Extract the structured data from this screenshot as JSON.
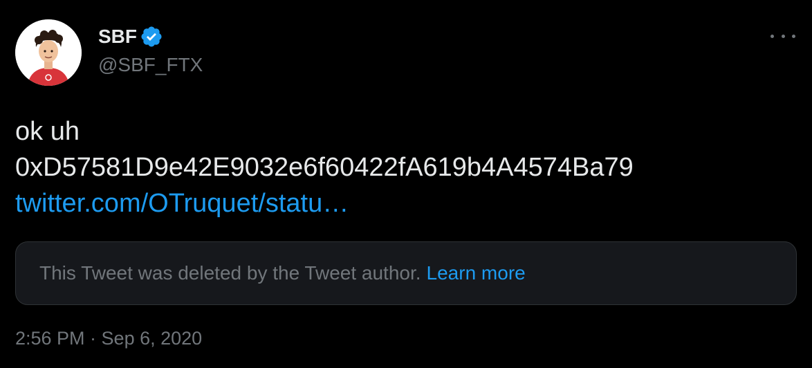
{
  "author": {
    "display_name": "SBF",
    "handle": "@SBF_FTX",
    "verified": true,
    "avatar_icon": "profile-photo-avatar"
  },
  "more_menu_icon": "more-horizontal-icon",
  "tweet": {
    "line1": "ok uh",
    "line2": "0xD57581D9e42E9032e6f60422fA619b4A4574Ba79",
    "link_text": "twitter.com/OTruquet/statu…"
  },
  "quoted_tweet": {
    "deleted_message": "This Tweet was deleted by the Tweet author.",
    "learn_more_label": "Learn more"
  },
  "timestamp": "2:56 PM · Sep 6, 2020",
  "colors": {
    "background": "#000000",
    "text_primary": "#e7e9ea",
    "text_secondary": "#71767b",
    "link": "#1d9bf0",
    "card_bg": "#16181c",
    "card_border": "#2f3336",
    "verified_badge": "#1d9bf0"
  }
}
